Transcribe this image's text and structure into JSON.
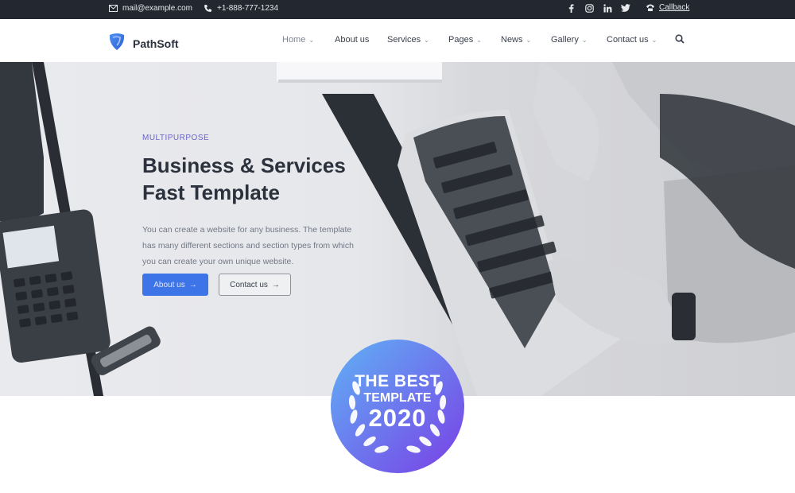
{
  "topbar": {
    "email": "mail@example.com",
    "phone": "+1-888-777-1234",
    "social_icons": [
      "facebook-icon",
      "instagram-icon",
      "linkedin-icon",
      "twitter-icon"
    ],
    "callback_label": "Callback"
  },
  "nav": {
    "brand": "PathSoft",
    "items": [
      {
        "label": "Home",
        "has_dropdown": true,
        "active": true
      },
      {
        "label": "About us",
        "has_dropdown": false
      },
      {
        "label": "Services",
        "has_dropdown": true
      },
      {
        "label": "Pages",
        "has_dropdown": true
      },
      {
        "label": "News",
        "has_dropdown": true
      },
      {
        "label": "Gallery",
        "has_dropdown": true
      },
      {
        "label": "Contact us",
        "has_dropdown": true
      }
    ],
    "search_icon": "search-icon"
  },
  "hero": {
    "eyebrow": "MULTIPURPOSE",
    "title_line1": "Business & Services",
    "title_line2": "Fast Template",
    "description": "You can create a website for any business. The template has many different sections and section types from which you can create your own unique website.",
    "primary_button": "About us",
    "secondary_button": "Contact us"
  },
  "badge": {
    "line1": "THE BEST",
    "line2": "TEMPLATE",
    "line3": "2020"
  },
  "colors": {
    "topbar_bg": "#23272f",
    "accent": "#3d74e8",
    "eyebrow": "#6c63c9",
    "heading": "#2b313d",
    "badge_start": "#5fb2f5",
    "badge_end": "#7a3fe6"
  }
}
